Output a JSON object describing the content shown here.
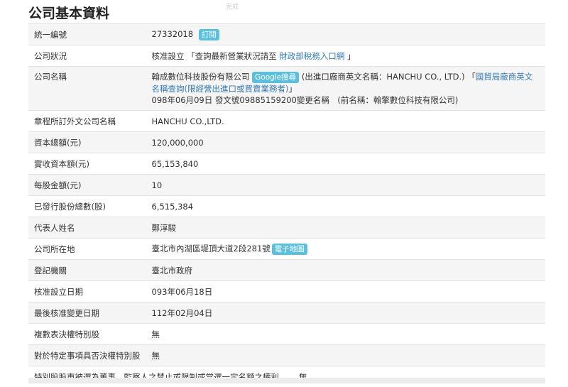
{
  "ghost_text": "完成",
  "title": "公司基本資料",
  "rows": {
    "ubn": {
      "label": "統一編號",
      "value": "27332018",
      "badge": "訂閱"
    },
    "status": {
      "label": "公司狀況",
      "value": "核准設立",
      "note_prefix": "「查詢最新營業狀況請至",
      "link": "財政部稅務入口網",
      "note_suffix": "」"
    },
    "name": {
      "label": "公司名稱",
      "value": "翰成數位科技股份有限公司",
      "badge": "Google搜尋",
      "en_note": "(出進口廠商英文名稱：HANCHU CO., LTD.)",
      "link_open": "「",
      "link": "國貿局廠商英文名稱查詢(限經營出進口或買賣業務者)",
      "link_close": "」",
      "change_note": "098年06月09日 發文號09885159200變更名稱　(前名稱：翰擎數位科技有限公司)"
    },
    "foreign_name": {
      "label": "章程所訂外文公司名稱",
      "value": "HANCHU CO.,LTD."
    },
    "capital_total": {
      "label": "資本總額(元)",
      "value": "120,000,000"
    },
    "capital_paid": {
      "label": "實收資本額(元)",
      "value": "65,153,840"
    },
    "par_value": {
      "label": "每股金額(元)",
      "value": "10"
    },
    "shares": {
      "label": "已發行股份總數(股)",
      "value": "6,515,384"
    },
    "representative": {
      "label": "代表人姓名",
      "value": "鄭淳駿"
    },
    "address": {
      "label": "公司所在地",
      "value": "臺北市內湖區堤頂大道2段281號",
      "badge": "電子地圖"
    },
    "authority": {
      "label": "登記機關",
      "value": "臺北市政府"
    },
    "approved_date": {
      "label": "核准設立日期",
      "value": "093年06月18日"
    },
    "last_change": {
      "label": "最後核准變更日期",
      "value": "112年02月04日"
    },
    "multi_vote": {
      "label": "複數表決權特別股",
      "value": "無"
    },
    "veto": {
      "label": "對於特定事項具否決權特別股",
      "value": "無"
    },
    "director_right": {
      "label": "特別股股東被選為董事、監察人之禁止或限制或當選一定名額之權利",
      "value": "無"
    }
  }
}
